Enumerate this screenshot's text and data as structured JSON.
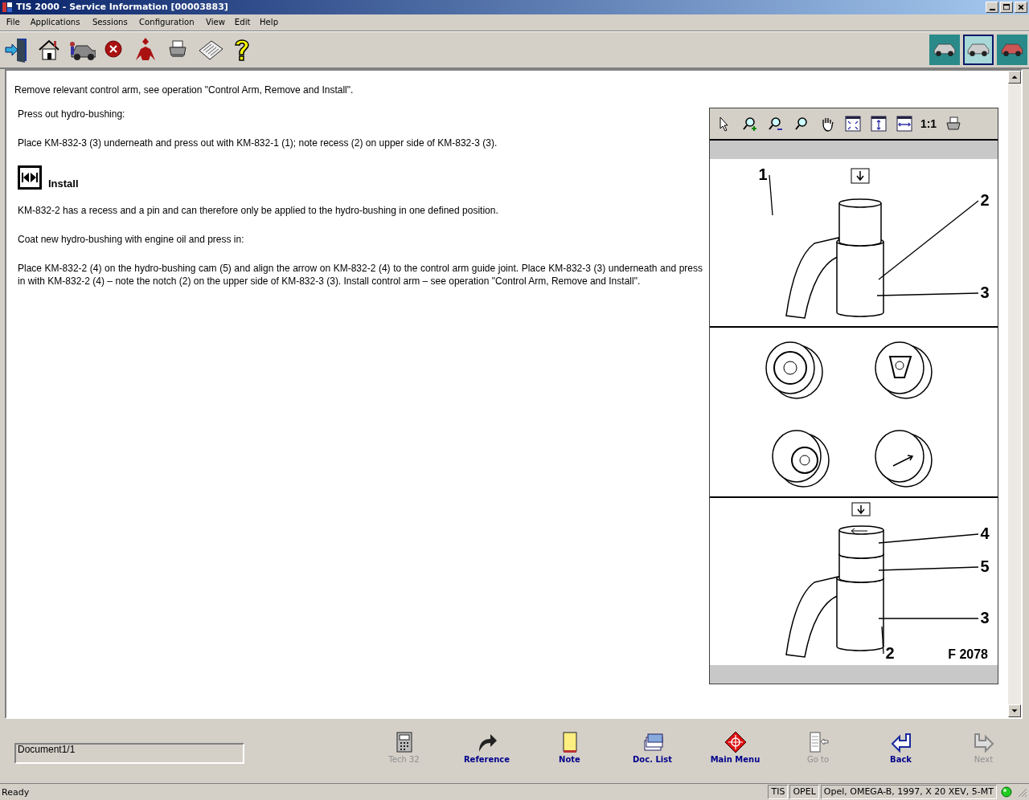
{
  "window": {
    "title": "TIS 2000 - Service Information [00003883]"
  },
  "menu": [
    "File",
    "Applications",
    "Sessions",
    "Configuration",
    "View",
    "Edit",
    "Help"
  ],
  "toolbar": [
    {
      "kind": "exit"
    },
    {
      "kind": "home"
    },
    {
      "kind": "vehicle"
    },
    {
      "kind": "cancel"
    },
    {
      "kind": "person"
    },
    {
      "kind": "print"
    },
    {
      "kind": "news"
    },
    {
      "kind": "help"
    }
  ],
  "vehicle_buttons": [
    {
      "selected": false
    },
    {
      "selected": true
    },
    {
      "selected": false
    }
  ],
  "content": {
    "intro": "Remove relevant control arm, see operation \"Control Arm, Remove and Install\".",
    "blocks": [
      {
        "kind": "text",
        "text": "Press out hydro-bushing:"
      },
      {
        "kind": "text",
        "text": "Place KM-832-3 (3) underneath and press out with KM-832-1 (1); note recess (2) on upper side of KM-832-3 (3)."
      },
      {
        "kind": "heading",
        "text": "Install"
      },
      {
        "kind": "text",
        "text": "KM-832-2 has a recess and a pin and can therefore only be applied to the hydro-bushing in one defined position."
      },
      {
        "kind": "text",
        "text": "Coat new hydro-bushing with engine oil and press in:"
      },
      {
        "kind": "text",
        "text": "Place KM-832-2 (4) on the hydro-bushing cam (5) and align the arrow on KM-832-2 (4) to the control arm guide joint. Place KM-832-3 (3) underneath and press in with KM-832-2 (4) – note the notch (2) on the upper side of KM-832-3 (3). Install control arm – see operation \"Control Arm, Remove and Install\"."
      }
    ]
  },
  "figure": {
    "tools": [
      {
        "kind": "pointer"
      },
      {
        "kind": "zoom-in"
      },
      {
        "kind": "zoom-out"
      },
      {
        "kind": "zoom"
      },
      {
        "kind": "pan"
      },
      {
        "kind": "fit"
      },
      {
        "kind": "fit-height"
      },
      {
        "kind": "fit-width"
      },
      {
        "kind": "actual",
        "label": "1:1"
      },
      {
        "kind": "print"
      }
    ],
    "panels": [
      {
        "kind": "removal",
        "callouts": [
          "1",
          "2",
          "3"
        ]
      },
      {
        "kind": "variants"
      },
      {
        "kind": "installation",
        "callouts": [
          "4",
          "5",
          "3",
          "2"
        ],
        "code": "F 2078"
      }
    ]
  },
  "document_field": {
    "value": "Document1/1"
  },
  "nav_buttons": [
    {
      "kind": "calculator",
      "label": "Tech 32",
      "disabled": true
    },
    {
      "kind": "reference",
      "label": "Reference",
      "disabled": false
    },
    {
      "kind": "note",
      "label": "Note",
      "disabled": false
    },
    {
      "kind": "list",
      "label": "Doc. List",
      "disabled": false
    },
    {
      "kind": "menu",
      "label": "Main Menu",
      "disabled": false
    },
    {
      "kind": "goto",
      "label": "Go to",
      "disabled": true
    },
    {
      "kind": "back",
      "label": "Back",
      "disabled": false
    },
    {
      "kind": "next",
      "label": "Next",
      "disabled": true
    }
  ],
  "status_bar": {
    "text": "Ready",
    "panes": [
      "TIS",
      "OPEL",
      "Opel, OMEGA-B, 1997, X 20 XEV, 5-MT"
    ]
  }
}
